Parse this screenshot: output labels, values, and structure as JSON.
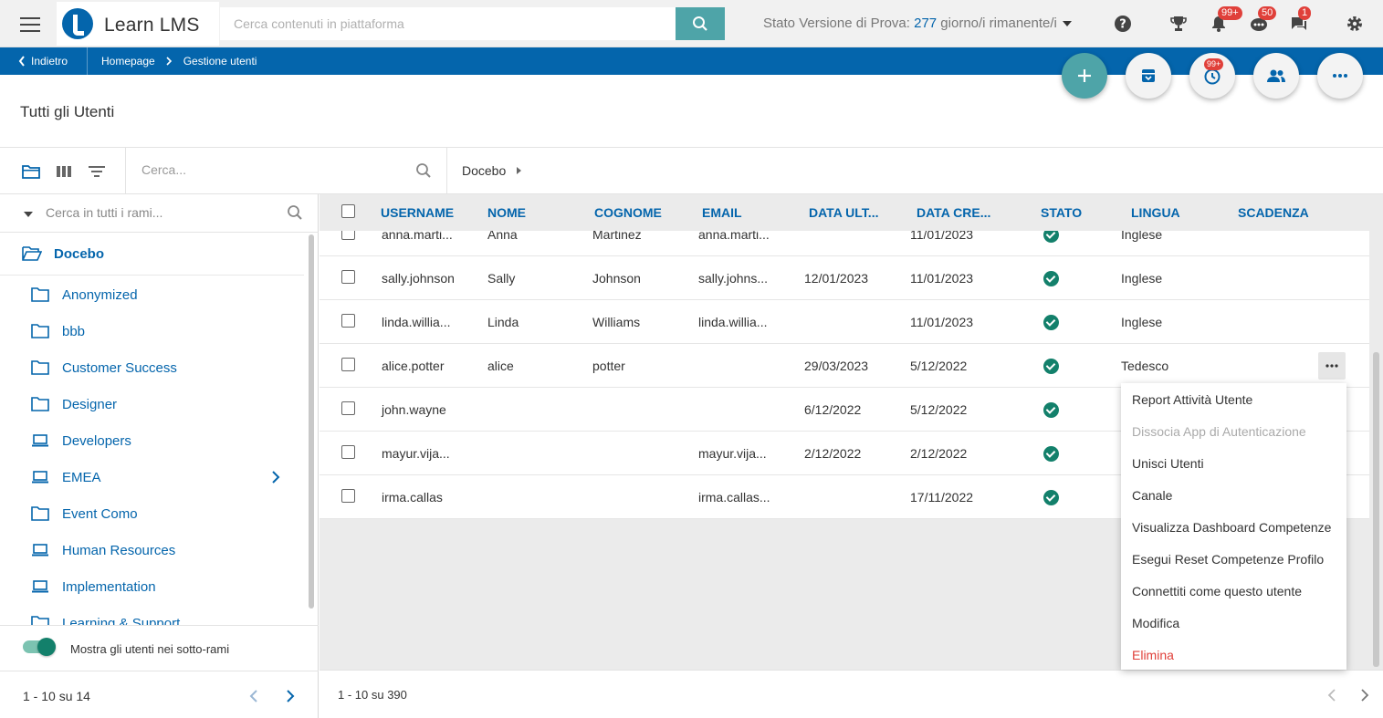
{
  "app": {
    "name": "Learn LMS"
  },
  "header": {
    "search_placeholder": "Cerca contenuti in piattaforma",
    "trial_prefix": "Stato Versione di Prova: ",
    "trial_days": "277",
    "trial_suffix": " giorno/i rimanente/i",
    "badges": {
      "notifications": "99+",
      "messages": "50",
      "chat": "1"
    }
  },
  "nav": {
    "back_label": "Indietro",
    "breadcrumbs": [
      "Homepage",
      "Gestione utenti"
    ]
  },
  "fab": {
    "history_badge": "99+"
  },
  "page": {
    "title": "Tutti gli Utenti"
  },
  "toolbar": {
    "search_placeholder": "Cerca...",
    "current_branch": "Docebo"
  },
  "tree": {
    "search_placeholder": "Cerca in tutti i rami...",
    "root_label": "Docebo",
    "items": [
      {
        "label": "Anonymized",
        "icon": "folder-icon"
      },
      {
        "label": "bbb",
        "icon": "folder-icon"
      },
      {
        "label": "Customer Success",
        "icon": "folder-icon"
      },
      {
        "label": "Designer",
        "icon": "folder-icon"
      },
      {
        "label": "Developers",
        "icon": "laptop-icon"
      },
      {
        "label": "EMEA",
        "icon": "laptop-icon",
        "has_children": true
      },
      {
        "label": "Event Como",
        "icon": "folder-icon"
      },
      {
        "label": "Human Resources",
        "icon": "laptop-icon"
      },
      {
        "label": "Implementation",
        "icon": "laptop-icon"
      },
      {
        "label": "Learning & Support",
        "icon": "folder-icon"
      }
    ],
    "toggle_label": "Mostra gli utenti nei sotto-rami",
    "toggle_on": true,
    "pagination": "1 - 10 su 14"
  },
  "table": {
    "columns": [
      "USERNAME",
      "NOME",
      "COGNOME",
      "EMAIL",
      "DATA ULT...",
      "DATA CRE...",
      "STATO",
      "LINGUA",
      "SCADENZA"
    ],
    "rows": [
      {
        "username": "anna.marti...",
        "nome": "Anna",
        "cognome": "Martinez",
        "email": "anna.marti...",
        "data_ult": "",
        "data_cre": "11/01/2023",
        "lingua": "Inglese"
      },
      {
        "username": "sally.johnson",
        "nome": "Sally",
        "cognome": "Johnson",
        "email": "sally.johns...",
        "data_ult": "12/01/2023",
        "data_cre": "11/01/2023",
        "lingua": "Inglese"
      },
      {
        "username": "linda.willia...",
        "nome": "Linda",
        "cognome": "Williams",
        "email": "linda.willia...",
        "data_ult": "",
        "data_cre": "11/01/2023",
        "lingua": "Inglese"
      },
      {
        "username": "alice.potter",
        "nome": "alice",
        "cognome": "potter",
        "email": "",
        "data_ult": "29/03/2023",
        "data_cre": "5/12/2022",
        "lingua": "Tedesco"
      },
      {
        "username": "john.wayne",
        "nome": "",
        "cognome": "",
        "email": "",
        "data_ult": "6/12/2022",
        "data_cre": "5/12/2022",
        "lingua": ""
      },
      {
        "username": "mayur.vija...",
        "nome": "",
        "cognome": "",
        "email": "mayur.vija...",
        "data_ult": "2/12/2022",
        "data_cre": "2/12/2022",
        "lingua": ""
      },
      {
        "username": "irma.callas",
        "nome": "",
        "cognome": "",
        "email": "irma.callas...",
        "data_ult": "",
        "data_cre": "17/11/2022",
        "lingua": ""
      }
    ],
    "pagination": "1 - 10 su 390"
  },
  "context_menu": {
    "items": [
      {
        "label": "Report Attività Utente"
      },
      {
        "label": "Dissocia App di Autenticazione",
        "disabled": true
      },
      {
        "label": "Unisci Utenti"
      },
      {
        "label": "Canale"
      },
      {
        "label": "Visualizza Dashboard Competenze"
      },
      {
        "label": "Esegui Reset Competenze Profilo"
      },
      {
        "label": "Connettiti come questo utente"
      },
      {
        "label": "Modifica"
      },
      {
        "label": "Elimina",
        "danger": true
      }
    ]
  },
  "colors": {
    "brand": "#0465ac",
    "accent": "#4ea4a8",
    "success": "#13806b",
    "danger": "#e0403a"
  }
}
